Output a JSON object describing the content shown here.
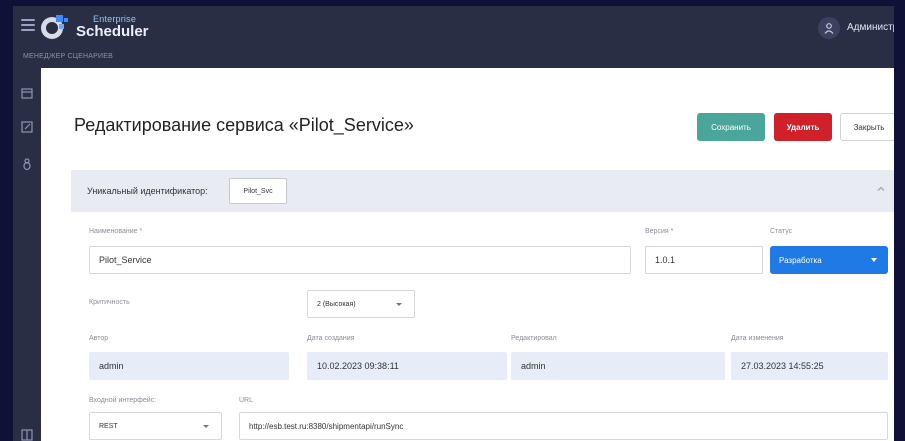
{
  "app": {
    "logo_enterprise": "Enterprise",
    "logo_scheduler": "Scheduler",
    "section_label": "МЕНЕДЖЕР СЦЕНАРИЕВ",
    "user_name": "Администр"
  },
  "page": {
    "title": "Редактирование сервиса «Pilot_Service»"
  },
  "actions": {
    "save_label": "Сохранить",
    "delete_label": "Удалить",
    "close_label": "Закрыть"
  },
  "id_panel": {
    "label": "Уникальный идентификатор:",
    "value": "Pilot_Svc"
  },
  "form": {
    "name_label": "Наименование *",
    "name_value": "Pilot_Service",
    "version_label": "Версия *",
    "version_value": "1.0.1",
    "status_label": "Статус",
    "status_value": "Разработка",
    "criticality_label": "Критичность",
    "criticality_value": "2 (Высокая)",
    "author_label": "Автор",
    "author_value": "admin",
    "created_label": "Дата создания",
    "created_value": "10.02.2023 09:38:11",
    "editor_label": "Редактировал",
    "editor_value": "admin",
    "modified_label": "Дата изменения",
    "modified_value": "27.03.2023 14:55:25",
    "interface_label": "Входной интерфейс:",
    "interface_value": "REST",
    "url_label": "URL",
    "url_value": "http://esb.test.ru:8380/shipmentapi/runSync"
  },
  "colors": {
    "topbar": "#2a2e45",
    "save": "#4aa69a",
    "delete": "#d0202a",
    "status": "#1f7ae6",
    "readonly_field": "#e6ecf8"
  },
  "icons": {
    "menu": "menu-icon",
    "logo": "logo-icon",
    "user": "user-icon",
    "sidebar": [
      "calendar-icon",
      "edit-icon",
      "bug-icon",
      "docs-icon"
    ],
    "collapse": "chevron-up-icon"
  }
}
